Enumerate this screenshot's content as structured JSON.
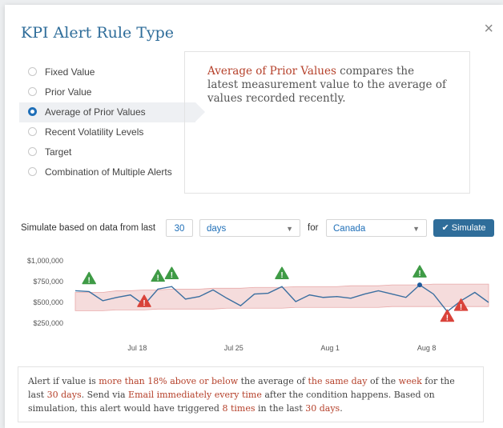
{
  "dialog": {
    "title": "KPI Alert Rule Type",
    "close_symbol": "×"
  },
  "rule_types": [
    {
      "label": "Fixed Value",
      "selected": false
    },
    {
      "label": "Prior Value",
      "selected": false
    },
    {
      "label": "Average of Prior Values",
      "selected": true
    },
    {
      "label": "Recent Volatility Levels",
      "selected": false
    },
    {
      "label": "Target",
      "selected": false
    },
    {
      "label": "Combination of Multiple Alerts",
      "selected": false
    }
  ],
  "description": {
    "highlight": "Average of Prior Values",
    "text": " compares the latest measurement value to the average of values recorded recently."
  },
  "simulate": {
    "label": "Simulate based on data from last",
    "days_value": "30",
    "unit": "days",
    "for_label": "for",
    "country": "Canada",
    "button_label": "Simulate"
  },
  "colors": {
    "accent": "#2f6d9a",
    "line": "#3b6fa0",
    "band": "#f2d3d3",
    "warn_green": "#3f9b46",
    "warn_red": "#d9433a",
    "highlight": "#b5402a"
  },
  "chart_data": {
    "type": "line",
    "y_ticks": [
      "$1,000,000",
      "$750,000",
      "$500,000",
      "$250,000"
    ],
    "y_tick_values": [
      1000000,
      750000,
      500000,
      250000
    ],
    "ylim": [
      250000,
      1000000
    ],
    "x_ticks": [
      "Jul 18",
      "Jul 25",
      "Aug 1",
      "Aug 8"
    ],
    "x_tick_index": [
      4.5,
      11.5,
      18.5,
      25.5
    ],
    "series": [
      {
        "values": [
          640000,
          630000,
          520000,
          560000,
          590000,
          470000,
          660000,
          690000,
          540000,
          570000,
          650000,
          550000,
          460000,
          600000,
          610000,
          690000,
          510000,
          590000,
          560000,
          570000,
          550000,
          600000,
          640000,
          600000,
          560000,
          710000,
          600000,
          390000,
          520000,
          620000,
          500000
        ]
      }
    ],
    "band_upper": [
      620000,
      620000,
      620000,
      640000,
      640000,
      650000,
      650000,
      660000,
      660000,
      660000,
      670000,
      670000,
      670000,
      680000,
      680000,
      680000,
      690000,
      690000,
      690000,
      690000,
      700000,
      700000,
      700000,
      710000,
      710000,
      710000,
      720000,
      720000,
      720000,
      720000,
      720000
    ],
    "band_lower": [
      400000,
      400000,
      400000,
      410000,
      410000,
      410000,
      420000,
      420000,
      420000,
      420000,
      420000,
      430000,
      430000,
      430000,
      430000,
      430000,
      440000,
      440000,
      440000,
      440000,
      440000,
      440000,
      440000,
      450000,
      450000,
      450000,
      450000,
      450000,
      450000,
      450000,
      450000
    ],
    "alerts": [
      {
        "index": 1,
        "kind": "above"
      },
      {
        "index": 5,
        "kind": "below"
      },
      {
        "index": 6,
        "kind": "above"
      },
      {
        "index": 7,
        "kind": "above"
      },
      {
        "index": 15,
        "kind": "above"
      },
      {
        "index": 25,
        "kind": "above"
      },
      {
        "index": 27,
        "kind": "below"
      },
      {
        "index": 28,
        "kind": "below"
      }
    ],
    "points": [
      {
        "index": 25,
        "value": 710000
      },
      {
        "index": 27,
        "value": 340000
      }
    ]
  },
  "summary": {
    "parts": [
      {
        "text": "Alert if value is ",
        "hl": false
      },
      {
        "text": "more than 18% above or below",
        "hl": true
      },
      {
        "text": " the average of ",
        "hl": false
      },
      {
        "text": "the same day",
        "hl": true
      },
      {
        "text": " of the ",
        "hl": false
      },
      {
        "text": "week",
        "hl": true
      },
      {
        "text": " for the last ",
        "hl": false
      },
      {
        "text": "30 days",
        "hl": true
      },
      {
        "text": ". Send via ",
        "hl": false
      },
      {
        "text": "Email immediately every time",
        "hl": true
      },
      {
        "text": " after the condition happens. Based on simulation, this alert would have triggered ",
        "hl": false
      },
      {
        "text": "8 times",
        "hl": true
      },
      {
        "text": " in the last ",
        "hl": false
      },
      {
        "text": "30 days",
        "hl": true
      },
      {
        "text": ".",
        "hl": false
      }
    ]
  }
}
